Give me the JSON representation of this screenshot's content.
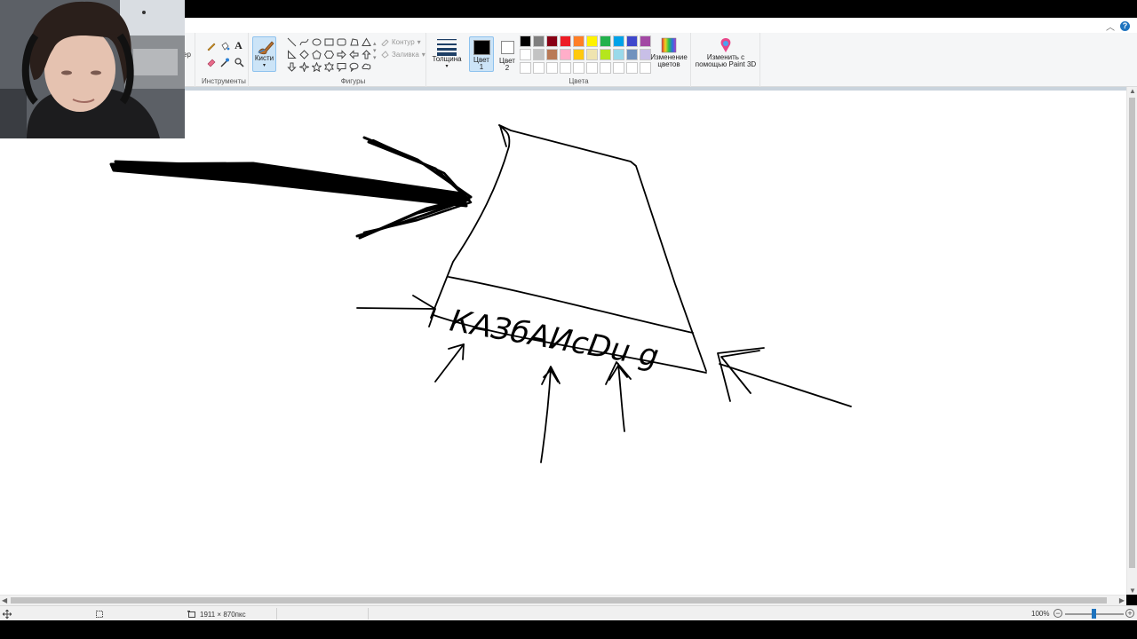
{
  "ribbon": {
    "tools_partial": "ер",
    "groups": {
      "tools": "Инструменты",
      "shapes": "Фигуры",
      "colors": "Цвета"
    },
    "brushes_label": "Кисти",
    "outline_label": "Контур",
    "fill_label": "Заливка",
    "size_label": "Толщина",
    "color1_label": "Цвет\n1",
    "color2_label": "Цвет\n2",
    "edit_colors_label": "Изменение цветов",
    "paint3d_label": "Изменить с помощью Paint 3D",
    "color1": "#000000",
    "color2": "#ffffff",
    "palette": [
      "#000000",
      "#7f7f7f",
      "#880015",
      "#ed1c24",
      "#ff7f27",
      "#fff200",
      "#22b14c",
      "#00a2e8",
      "#3f48cc",
      "#a349a4",
      "#ffffff",
      "#c3c3c3",
      "#b97a57",
      "#ffaec9",
      "#ffc90e",
      "#efe4b0",
      "#b5e61d",
      "#99d9ea",
      "#7092be",
      "#c8bfe7",
      "#ffffff",
      "#ffffff",
      "#ffffff",
      "#ffffff",
      "#ffffff",
      "#ffffff",
      "#ffffff",
      "#ffffff",
      "#ffffff",
      "#ffffff"
    ]
  },
  "canvas": {
    "text": "КАЗбАИсDu g",
    "background": "#ffffff",
    "stroke": "#000000"
  },
  "status": {
    "dimensions": "1911 × 870пкс",
    "zoom": "100%",
    "zoom_fraction": 0.5
  }
}
